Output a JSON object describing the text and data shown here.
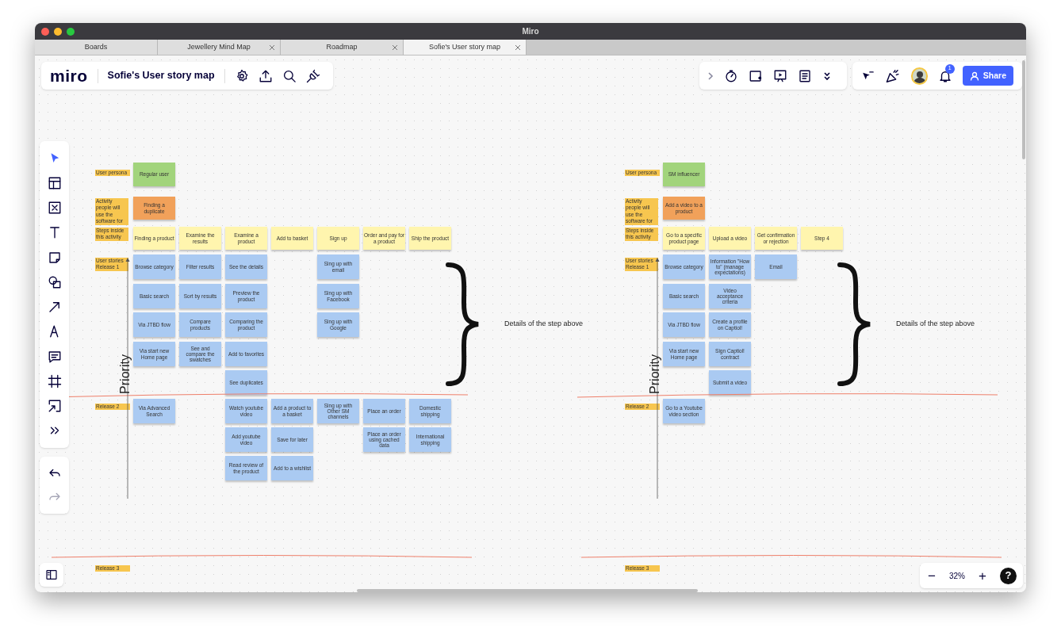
{
  "window": {
    "title": "Miro"
  },
  "tabs": [
    {
      "label": "Boards",
      "selected": false,
      "closable": false
    },
    {
      "label": "Jewellery Mind Map",
      "selected": false,
      "closable": true
    },
    {
      "label": "Roadmap",
      "selected": false,
      "closable": true
    },
    {
      "label": "Sofie's User story map",
      "selected": true,
      "closable": true
    }
  ],
  "board": {
    "logo": "miro",
    "title": "Sofie's User story map",
    "notification_count": "1",
    "share": "Share",
    "zoom_out": "−",
    "zoom": "32%",
    "zoom_in": "+",
    "help": "?"
  },
  "maps": [
    {
      "labels": {
        "persona": "User persona",
        "activity": "Activity people will use the software for",
        "steps": "Steps inside this activity",
        "release1": "User stories Release 1",
        "release2": "Release 2",
        "release3": "Release 3"
      },
      "persona": "Regular user",
      "activity": "Finding a duplicate",
      "axis_label": "Priority",
      "brace_note": "Details of the step above",
      "columns": [
        {
          "step": "Finding a product",
          "release1": [
            "Browse category",
            "Basic search",
            "Via JTBD flow",
            "Via start new Home page"
          ],
          "release2": [
            "Via Advanced Search"
          ]
        },
        {
          "step": "Examine the results",
          "release1": [
            "Filter results",
            "Sort by results",
            "Compare products",
            "See and compare the swatches"
          ]
        },
        {
          "step": "Examine a product",
          "release1": [
            "See the details",
            "Preview the product",
            "Comparing the product",
            "Add to favorites",
            "See duplicates"
          ],
          "release2": [
            "Watch youtube video",
            "Add youtube video",
            "Read review of the product"
          ]
        },
        {
          "step": "Add to basket",
          "release2": [
            "Add a product to a basket",
            "Save for later",
            "Add to a wishlist"
          ]
        },
        {
          "step": "Sign up",
          "release1": [
            "Sing up with email",
            "Sing up with Facebook",
            "Sing up with Google"
          ],
          "release2": [
            "Sing up with Other SM channels"
          ]
        },
        {
          "step": "Order and pay for a product",
          "release2": [
            "Place an order",
            "Place an order using cached data"
          ]
        },
        {
          "step": "Ship the product",
          "release2": [
            "Domestic shipping",
            "International shipping"
          ]
        }
      ]
    },
    {
      "labels": {
        "persona": "User persona",
        "activity": "Activity people will use the software for",
        "steps": "Steps inside this activity",
        "release1": "User stories Release 1",
        "release2": "Release 2",
        "release3": "Release 3"
      },
      "persona": "SM influencer",
      "activity": "Add a video to a product",
      "axis_label": "Priority",
      "brace_note": "Details of the step above",
      "columns": [
        {
          "step": "Go to a specific product page",
          "release1": [
            "Browse category",
            "Basic search",
            "Via JTBD flow",
            "Via start new Home page"
          ],
          "release2": [
            "Go to a Youtube video section"
          ]
        },
        {
          "step": "Upload a video",
          "release1": [
            "Information \"How to\" (manage expectations)",
            "Video acceptance criteria",
            "Create a profile on Captiol!",
            "Sign Captiol! contract",
            "Submit a video"
          ]
        },
        {
          "step": "Get confirmation or rejection",
          "release1": [
            "Email"
          ]
        },
        {
          "step": "Step 4"
        }
      ]
    }
  ]
}
